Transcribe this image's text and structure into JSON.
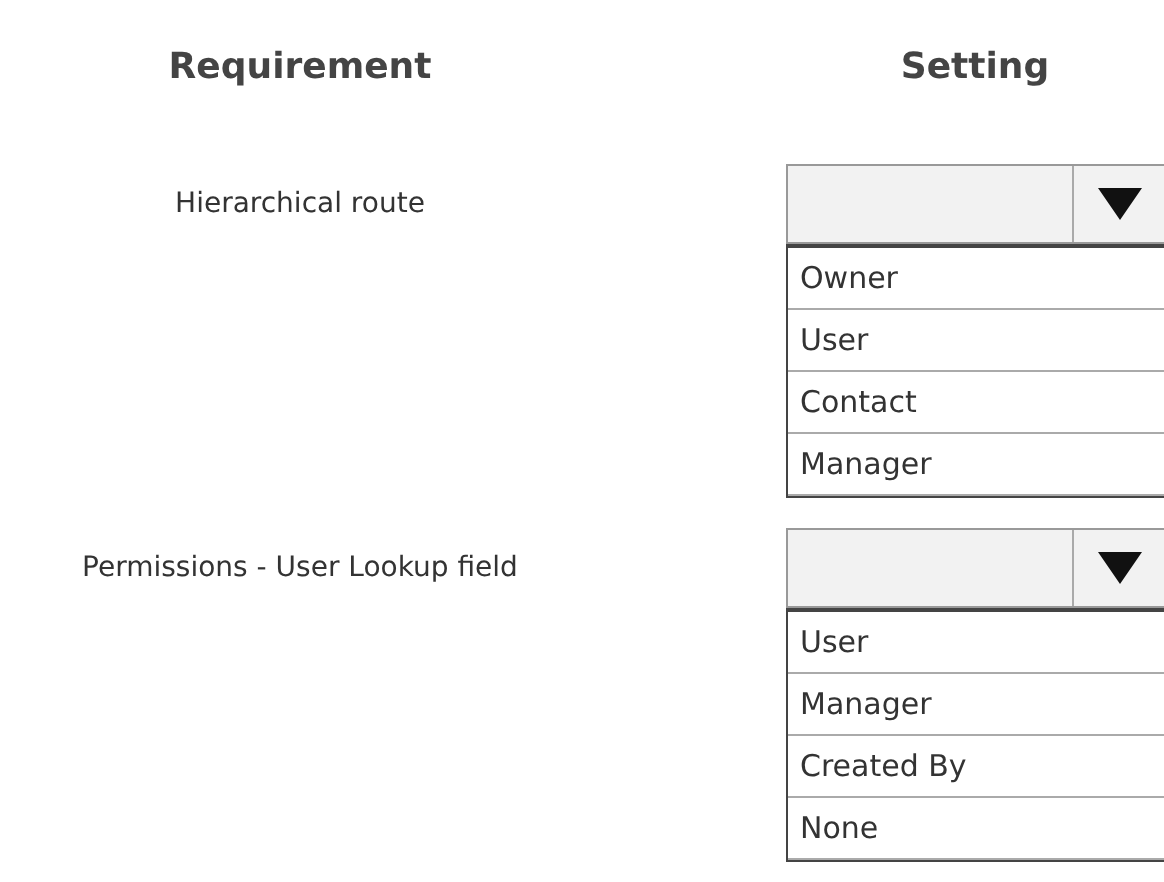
{
  "headers": [
    "Requirement",
    "Setting"
  ],
  "rows": [
    {
      "requirement": "Hierarchical route",
      "options": [
        "Owner",
        "User",
        "Contact",
        "Manager"
      ]
    },
    {
      "requirement": "Permissions - User Lookup field",
      "options": [
        "User",
        "Manager",
        "Created By",
        "None"
      ]
    }
  ]
}
